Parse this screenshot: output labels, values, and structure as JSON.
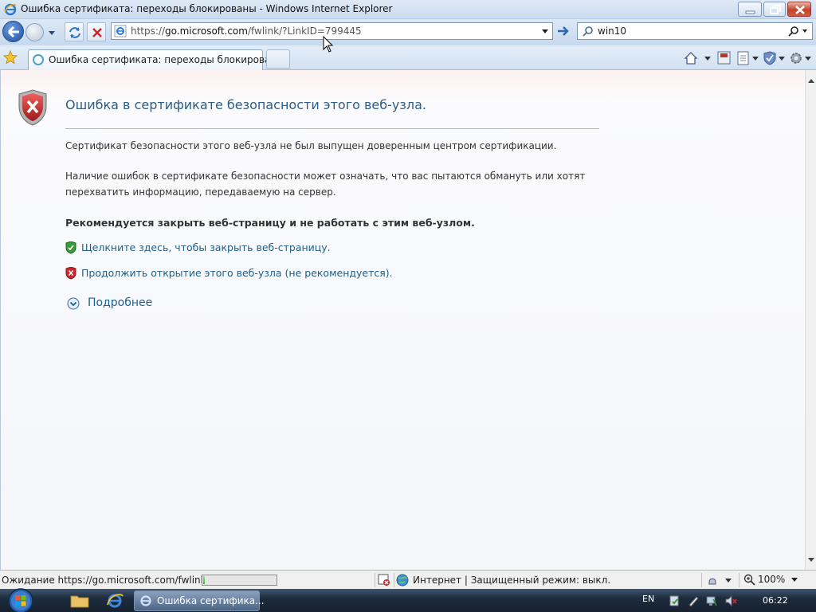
{
  "window": {
    "title": "Ошибка сертификата: переходы блокированы - Windows Internet Explorer"
  },
  "address": {
    "url_prefix": "https://",
    "url_domain": "go.microsoft.com",
    "url_path": "/fwlink/?LinkID=799445"
  },
  "search": {
    "value": "win10"
  },
  "tabs": [
    {
      "label": "Ошибка сертификата: переходы блокированы"
    }
  ],
  "page": {
    "heading": "Ошибка в сертификате безопасности этого веб-узла.",
    "para1": "Сертификат безопасности этого веб-узла не был выпущен доверенным центром сертификации.",
    "para2_line1": "Наличие ошибок в сертификате безопасности может означать, что вас пытаются обмануть или хотят",
    "para2_line2": "перехватить информацию, передаваемую на сервер.",
    "recommendation": "Рекомендуется закрыть веб-страницу и не работать с этим веб-узлом.",
    "close_link": "Щелкните здесь, чтобы закрыть веб-страницу.",
    "continue_link": "Продолжить открытие этого веб-узла (не рекомендуется).",
    "more_info": "Подробнее"
  },
  "status": {
    "text": "Ожидание https://go.microsoft.com/fwlink/?L",
    "progress": 0.02,
    "zone": "Интернет | Защищенный режим: выкл.",
    "zoom": "100%"
  },
  "taskbar": {
    "task_label": "Ошибка сертифика...",
    "language": "EN",
    "clock": "06:22"
  },
  "colors": {
    "link": "#1f5f8b",
    "heading": "#2d5c86",
    "error_red": "#c8282b",
    "ok_green": "#3a9a3a"
  }
}
